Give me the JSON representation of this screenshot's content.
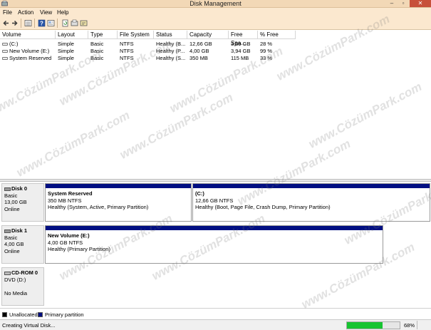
{
  "window": {
    "title": "Disk Management"
  },
  "menu": [
    {
      "label": "File"
    },
    {
      "label": "Action"
    },
    {
      "label": "View"
    },
    {
      "label": "Help"
    }
  ],
  "toolbar": {
    "icons": [
      "back-icon",
      "forward-icon",
      "list-view-icon",
      "help-icon",
      "properties-icon",
      "refresh-icon",
      "rescan-icon",
      "settings-icon"
    ]
  },
  "volumes": {
    "columns": [
      "Volume",
      "Layout",
      "Type",
      "File System",
      "Status",
      "Capacity",
      "Free Spa...",
      "% Free"
    ],
    "rows": [
      {
        "volume": "(C:)",
        "layout": "Simple",
        "type": "Basic",
        "fs": "NTFS",
        "status": "Healthy (B...",
        "capacity": "12,66 GB",
        "free": "3,59 GB",
        "pct": "28 %"
      },
      {
        "volume": "New Volume (E:)",
        "layout": "Simple",
        "type": "Basic",
        "fs": "NTFS",
        "status": "Healthy (P...",
        "capacity": "4,00 GB",
        "free": "3,94 GB",
        "pct": "99 %"
      },
      {
        "volume": "System Reserved",
        "layout": "Simple",
        "type": "Basic",
        "fs": "NTFS",
        "status": "Healthy (S...",
        "capacity": "350 MB",
        "free": "115 MB",
        "pct": "33 %"
      }
    ]
  },
  "disks": [
    {
      "name": "Disk 0",
      "type": "Basic",
      "size": "13,00 GB",
      "state": "Online",
      "partitions": [
        {
          "name": "System Reserved",
          "size": "350 MB NTFS",
          "status": "Healthy (System, Active, Primary Partition)"
        },
        {
          "name": "(C:)",
          "size": "12,66 GB NTFS",
          "status": "Healthy (Boot, Page File, Crash Dump, Primary Partition)"
        }
      ]
    },
    {
      "name": "Disk 1",
      "type": "Basic",
      "size": "4,00 GB",
      "state": "Online",
      "partitions": [
        {
          "name": "New Volume  (E:)",
          "size": "4,00 GB NTFS",
          "status": "Healthy (Primary Partition)"
        }
      ]
    },
    {
      "name": "CD-ROM 0",
      "type": "DVD (D:)",
      "size": "",
      "state": "No Media",
      "partitions": []
    }
  ],
  "legend": {
    "unallocated": {
      "label": "Unallocated",
      "color": "#000000"
    },
    "primary": {
      "label": "Primary partition",
      "color": "#000f82"
    }
  },
  "status": {
    "message": "Creating Virtual Disk...",
    "progress": 68,
    "progress_label": "68%"
  },
  "watermark": "www.CözümPark.com"
}
